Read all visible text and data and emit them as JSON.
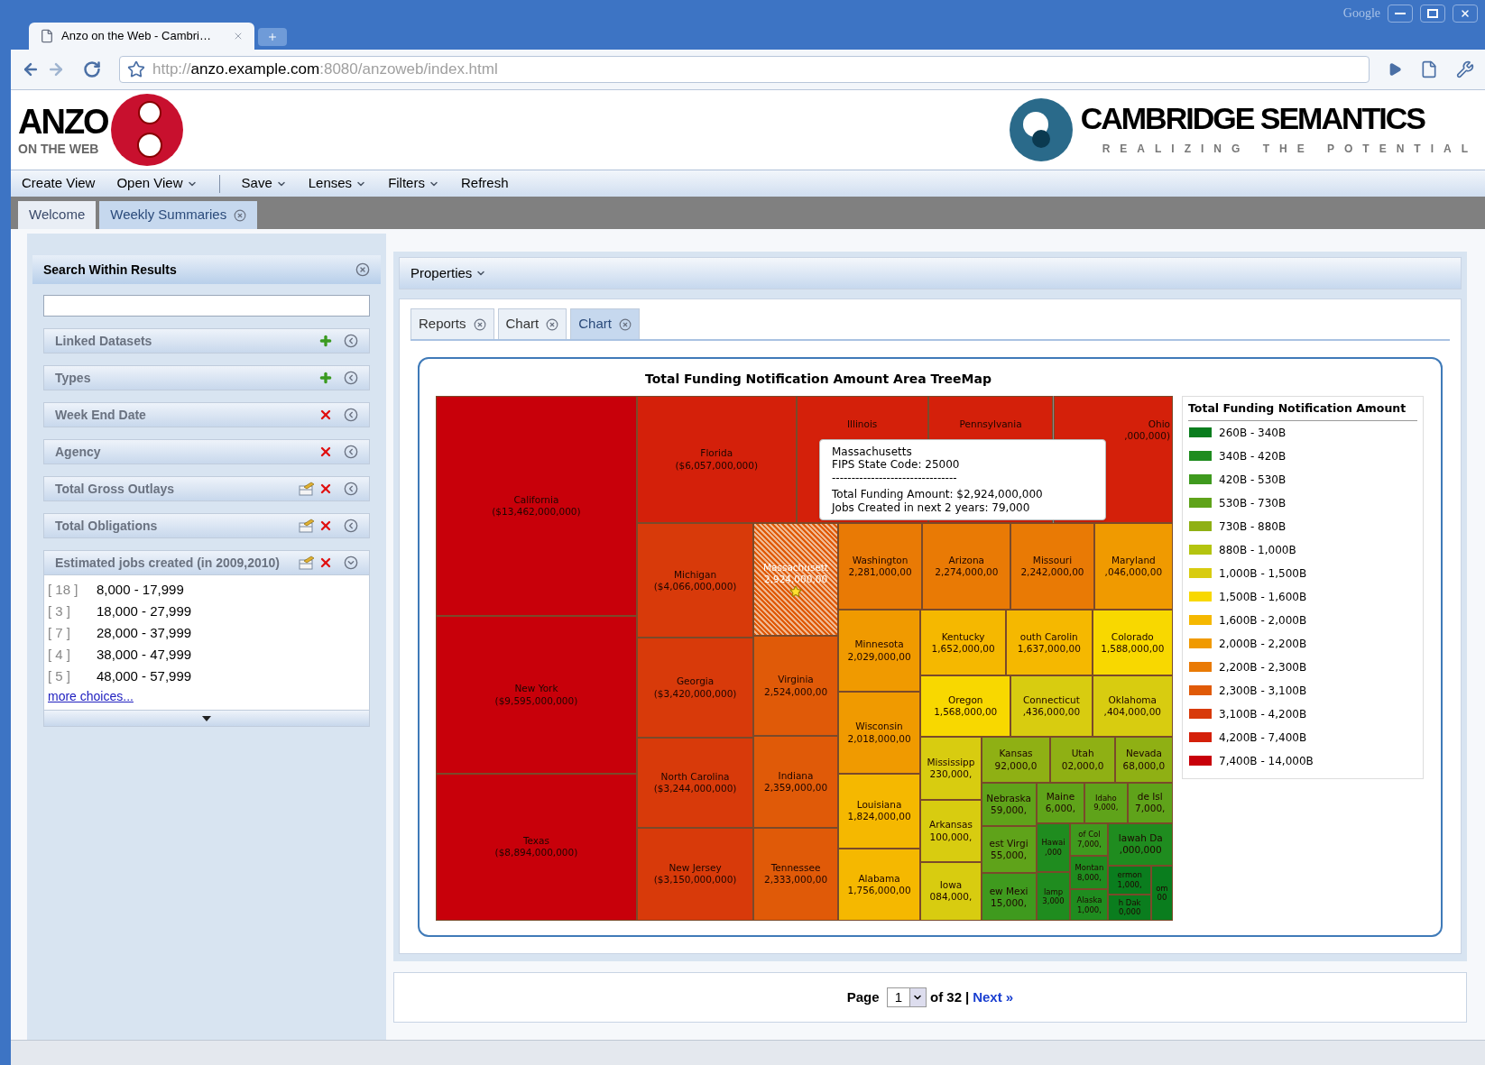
{
  "browser": {
    "tab_title": "Anzo on the Web - Cambri…",
    "corner_label": "Google",
    "url": {
      "scheme": "http://",
      "host": "anzo.example.com",
      "rest": ":8080/anzoweb/index.html"
    }
  },
  "header": {
    "logo_word": "ANZO",
    "logo_sub": "ON THE WEB",
    "brand": "CAMBRIDGE SEMANTICS",
    "tagline": "REALIZING THE POTENTIAL"
  },
  "menu": [
    {
      "label": "Create View",
      "has_menu": false
    },
    {
      "label": "Open View",
      "has_menu": true
    },
    {
      "label": "Save",
      "has_menu": true
    },
    {
      "label": "Lenses",
      "has_menu": true
    },
    {
      "label": "Filters",
      "has_menu": true
    },
    {
      "label": "Refresh",
      "has_menu": false
    }
  ],
  "tabs": [
    {
      "label": "Welcome",
      "selected": false,
      "closable": false
    },
    {
      "label": "Weekly Summaries",
      "selected": true,
      "closable": true
    }
  ],
  "search_panel": {
    "title": "Search Within Results",
    "facets": [
      {
        "label": "Linked Datasets",
        "kind": "add",
        "expanded": false
      },
      {
        "label": "Types",
        "kind": "add",
        "expanded": false
      },
      {
        "label": "Week End Date",
        "kind": "remove",
        "expanded": false
      },
      {
        "label": "Agency",
        "kind": "remove",
        "expanded": false
      },
      {
        "label": "Total Gross Outlays",
        "kind": "edit_remove",
        "expanded": false
      },
      {
        "label": "Total Obligations",
        "kind": "edit_remove",
        "expanded": false
      },
      {
        "label": "Estimated jobs created (in 2009,2010)",
        "kind": "edit_remove",
        "expanded": true
      }
    ],
    "choices": [
      {
        "count": "[ 18 ]",
        "range": "8,000 - 17,999"
      },
      {
        "count": "[ 3 ]",
        "range": "18,000 - 27,999"
      },
      {
        "count": "[ 7 ]",
        "range": "28,000 - 37,999"
      },
      {
        "count": "[ 4 ]",
        "range": "38,000 - 47,999"
      },
      {
        "count": "[ 5 ]",
        "range": "48,000 - 57,999"
      }
    ],
    "more_link": "more choices..."
  },
  "properties_label": "Properties",
  "view_tabs": [
    {
      "label": "Reports",
      "selected": false
    },
    {
      "label": "Chart",
      "selected": false
    },
    {
      "label": "Chart",
      "selected": true
    }
  ],
  "treemap": {
    "title": "Total Funding Notification Amount Area TreeMap",
    "cells": [
      {
        "label": "California",
        "value": "($13,462,000,000)",
        "color": "#c8000a",
        "selected": false
      },
      {
        "label": "New York",
        "value": "($9,595,000,000)",
        "color": "#c8000a",
        "selected": false
      },
      {
        "label": "Texas",
        "value": "($8,894,000,000)",
        "color": "#c8000a",
        "selected": false
      },
      {
        "label": "Florida",
        "value": "($6,057,000,000)",
        "color": "#d4200a",
        "selected": false
      },
      {
        "label": "Illinois",
        "color": "#d4200a",
        "selected": false
      },
      {
        "label": "Pennsylvania",
        "color": "#d4200a",
        "selected": false
      },
      {
        "label": "Ohio",
        "value": ",000,000)",
        "color": "#d4200a",
        "selected": false
      },
      {
        "label": "Michigan",
        "value": "($4,066,000,000)",
        "color": "#d83a0a",
        "selected": false
      },
      {
        "label": "Georgia",
        "value": "($3,420,000,000)",
        "color": "#d83a0a",
        "selected": false
      },
      {
        "label": "North Carolina",
        "value": "($3,244,000,000)",
        "color": "#d83a0a",
        "selected": false
      },
      {
        "label": "New Jersey",
        "value": "($3,150,000,000)",
        "color": "#d83a0a",
        "selected": false
      },
      {
        "label": "Massachusett",
        "value": "2,924,000,00",
        "color": "#e05a08",
        "selected": true
      },
      {
        "label": "Virginia",
        "value": "2,524,000,00",
        "color": "#e05a08",
        "selected": false
      },
      {
        "label": "Indiana",
        "value": "2,359,000,00",
        "color": "#e05a08",
        "selected": false
      },
      {
        "label": "Tennessee",
        "value": "2,333,000,00",
        "color": "#e05a08",
        "selected": false
      },
      {
        "label": "Washington",
        "value": "2,281,000,00",
        "color": "#e97a05",
        "selected": false
      },
      {
        "label": "Arizona",
        "value": "2,274,000,00",
        "color": "#e97a05",
        "selected": false
      },
      {
        "label": "Missouri",
        "value": "2,242,000,00",
        "color": "#e97a05",
        "selected": false
      },
      {
        "label": "Maryland",
        "value": ",046,000,00",
        "color": "#f09a00",
        "selected": false
      },
      {
        "label": "Minnesota",
        "value": "2,029,000,00",
        "color": "#f09a00",
        "selected": false
      },
      {
        "label": "Wisconsin",
        "value": "2,018,000,00",
        "color": "#f09a00",
        "selected": false
      },
      {
        "label": "Louisiana",
        "value": "1,824,000,00",
        "color": "#f5b800",
        "selected": false
      },
      {
        "label": "Alabama",
        "value": "1,756,000,00",
        "color": "#f5b800",
        "selected": false
      },
      {
        "label": "Kentucky",
        "value": "1,652,000,00",
        "color": "#f5b800",
        "selected": false
      },
      {
        "label": "outh Carolin",
        "value": "1,637,000,00",
        "color": "#f5b800",
        "selected": false
      },
      {
        "label": "Colorado",
        "value": "1,588,000,00",
        "color": "#f8d800",
        "selected": false
      },
      {
        "label": "Oregon",
        "value": "1,568,000,00",
        "color": "#f8d800",
        "selected": false
      },
      {
        "label": "Connecticut",
        "value": ",436,000,00",
        "color": "#d8cc10",
        "selected": false
      },
      {
        "label": "Oklahoma",
        "value": ",404,000,00",
        "color": "#d8cc10",
        "selected": false
      },
      {
        "label": "Mississipp",
        "value": "230,000,",
        "color": "#d8cc10",
        "selected": false
      },
      {
        "label": "Arkansas",
        "value": "100,000,",
        "color": "#d8cc10",
        "selected": false
      },
      {
        "label": "Iowa",
        "value": "084,000,",
        "color": "#d8cc10",
        "selected": false
      },
      {
        "label": "Kansas",
        "value": "92,000,0",
        "color": "#8fb014",
        "selected": false
      },
      {
        "label": "Utah",
        "value": "02,000,0",
        "color": "#8fb014",
        "selected": false
      },
      {
        "label": "Nevada",
        "value": "68,000,0",
        "color": "#8fb014",
        "selected": false
      },
      {
        "label": "Nebraska",
        "value": "59,000,",
        "color": "#5fa31a",
        "selected": false
      },
      {
        "label": "Maine",
        "value": "6,000,",
        "color": "#5fa31a",
        "selected": false
      },
      {
        "label": "Idaho",
        "value": "9,000,",
        "color": "#5fa31a",
        "selected": false
      },
      {
        "label": "de Isl",
        "value": "7,000,",
        "color": "#5fa31a",
        "selected": false
      },
      {
        "label": "est Virgi",
        "value": "55,000,",
        "color": "#5fa31a",
        "selected": false
      },
      {
        "label": "ew Mexi",
        "value": "15,000,",
        "color": "#3f9a1e",
        "selected": false
      },
      {
        "label": "Hawai",
        "value": ",000",
        "color": "#1f8c1f",
        "selected": false
      },
      {
        "label": "lamp",
        "value": "3,000",
        "color": "#1f8c1f",
        "selected": false
      },
      {
        "label": "of Col",
        "value": "7,000,",
        "color": "#3f9a1e",
        "selected": false
      },
      {
        "label": "Montan",
        "value": "8,000,",
        "color": "#1f8c1f",
        "selected": false
      },
      {
        "label": "Alaska",
        "value": "1,000,",
        "color": "#1f8c1f",
        "selected": false
      },
      {
        "label": "lawah Da",
        "value": ",000,000",
        "color": "#1f8c1f",
        "selected": false
      },
      {
        "label": "ermon",
        "value": "1,000,",
        "color": "#0a7d1e",
        "selected": false
      },
      {
        "label": "h Dak",
        "value": "0,000",
        "color": "#0a7d1e",
        "selected": false
      },
      {
        "label": "om",
        "value": "00",
        "color": "#0a7d1e",
        "selected": false
      }
    ],
    "tooltip": [
      "Massachusetts",
      "FIPS State Code: 25000",
      "--------------------------------",
      "Total Funding Amount: $2,924,000,000",
      "Jobs Created in next 2 years: 79,000"
    ],
    "legend": {
      "title": "Total Funding Notification Amount",
      "items": [
        {
          "label": "260B - 340B",
          "color": "#0a7d1e"
        },
        {
          "label": "340B - 420B",
          "color": "#1f8c1f"
        },
        {
          "label": "420B - 530B",
          "color": "#3f9a1e"
        },
        {
          "label": "530B - 730B",
          "color": "#5fa31a"
        },
        {
          "label": "730B - 880B",
          "color": "#8fb014"
        },
        {
          "label": "880B - 1,000B",
          "color": "#b4c410"
        },
        {
          "label": "1,000B - 1,500B",
          "color": "#d8cc10"
        },
        {
          "label": "1,500B - 1,600B",
          "color": "#f8d800"
        },
        {
          "label": "1,600B - 2,000B",
          "color": "#f5b800"
        },
        {
          "label": "2,000B - 2,200B",
          "color": "#f09a00"
        },
        {
          "label": "2,200B - 2,300B",
          "color": "#e97a05"
        },
        {
          "label": "2,300B - 3,100B",
          "color": "#e05a08"
        },
        {
          "label": "3,100B - 4,200B",
          "color": "#d83a0a"
        },
        {
          "label": "4,200B - 7,400B",
          "color": "#d4200a"
        },
        {
          "label": "7,400B - 14,000B",
          "color": "#c8000a"
        }
      ]
    }
  },
  "pager": {
    "label": "Page",
    "page": "1",
    "of": "of 32",
    "separator": "|",
    "next": "Next »"
  }
}
